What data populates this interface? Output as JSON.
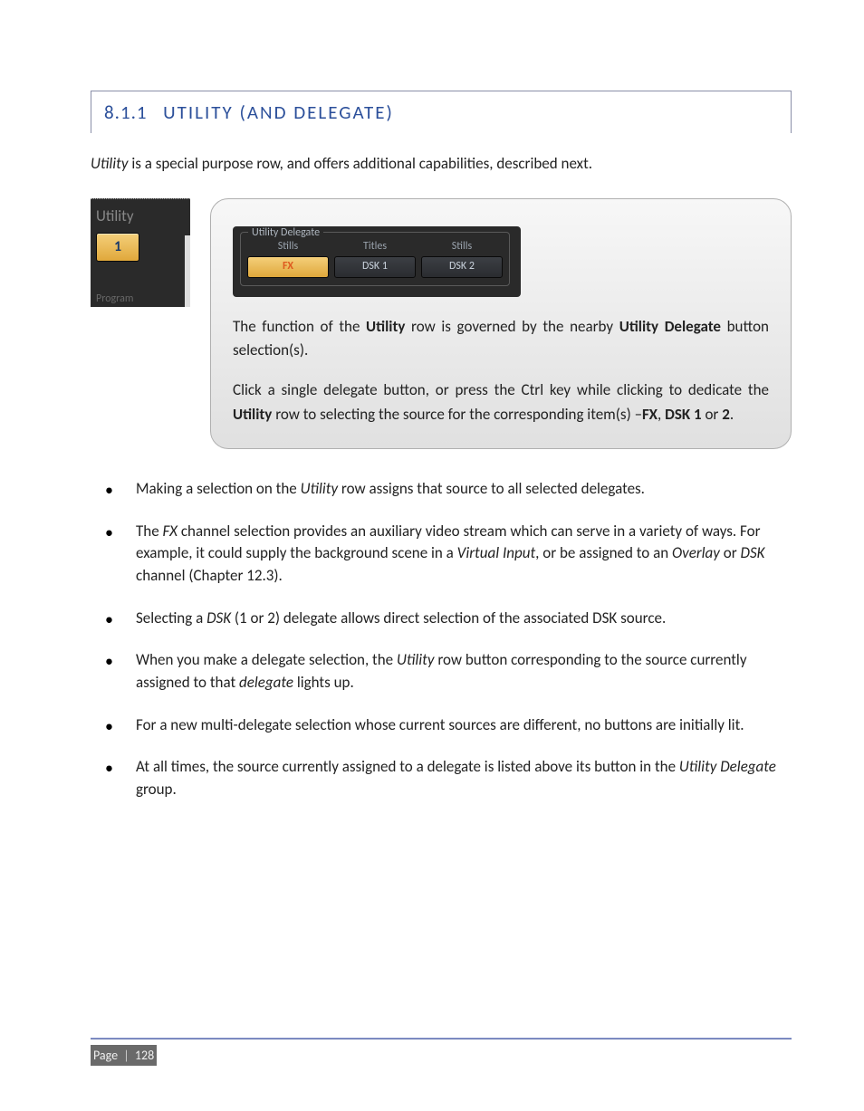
{
  "heading": {
    "number": "8.1.1",
    "title": "UTILITY (AND DELEGATE)"
  },
  "intro": {
    "prefix_italic": "Utility",
    "rest": " is a special purpose row, and offers additional capabilities, described next."
  },
  "left_panel": {
    "label": "Utility",
    "button": "1",
    "bottom": "Program"
  },
  "delegate_group": {
    "legend": "Utility Delegate",
    "top_labels": [
      "Stills",
      "Titles",
      "Stills"
    ],
    "buttons": [
      "FX",
      "DSK 1",
      "DSK 2"
    ]
  },
  "callout": {
    "p1_a": "The function of the ",
    "p1_b_bold": "Utility",
    "p1_c": " row is governed by the nearby ",
    "p1_d_bold": "Utility Delegate",
    "p1_e": " button selection(s).",
    "p2_a": "Click a single delegate button, or press the Ctrl key while clicking to dedicate the ",
    "p2_b_bold": "Utility",
    "p2_c": " row to selecting the source for the corresponding item(s) –",
    "p2_d_bold": "FX",
    "p2_e": ", ",
    "p2_f_bold": "DSK 1",
    "p2_g": " or ",
    "p2_h_bold": "2",
    "p2_i": "."
  },
  "bullets": {
    "b1_a": "Making a selection on the ",
    "b1_b_it": "Utility",
    "b1_c": " row assigns that source to all selected delegates.",
    "b2_a": "The ",
    "b2_b_it": "FX",
    "b2_c": " channel selection provides an auxiliary video stream which can serve in a variety of ways. For example, it could supply the background scene in a ",
    "b2_d_it": "Virtual Input",
    "b2_e": ", or be assigned to an ",
    "b2_f_it": "Overlay",
    "b2_g": " or ",
    "b2_h_it": "DSK",
    "b2_i": " channel (Chapter 12.3).",
    "b3_a": "Selecting a ",
    "b3_b_it": "DSK",
    "b3_c": " (1 or 2) delegate allows direct selection of the associated DSK source.",
    "b4_a": "When you make a delegate selection, the ",
    "b4_b_it": "Utility",
    "b4_c": " row button corresponding to the source currently assigned to that ",
    "b4_d_it": "delegate",
    "b4_e": " lights up.",
    "b5": "For a new multi-delegate selection whose current sources are different, no buttons are initially lit.",
    "b6_a": "At all times, the source currently assigned to a delegate is listed above its button in the ",
    "b6_b_it": "Utility Delegate",
    "b6_c": " group."
  },
  "footer": {
    "label": "Page",
    "sep": "|",
    "number": "128"
  }
}
